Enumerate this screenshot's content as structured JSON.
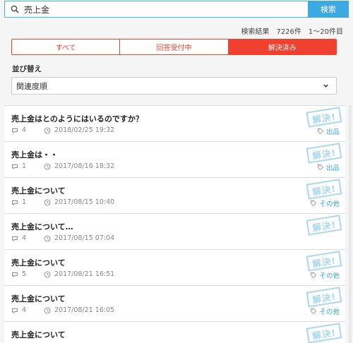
{
  "search": {
    "query": "売上金",
    "button_label": "検索"
  },
  "result_info": {
    "label": "検索結果",
    "count": "7226件",
    "range": "1〜20件目"
  },
  "tabs": [
    {
      "label": "すべて"
    },
    {
      "label": "回答受付中"
    },
    {
      "label": "解決済み"
    }
  ],
  "sort": {
    "label": "並び替え",
    "selected": "関連度順"
  },
  "stamp_text": "解決!",
  "questions": [
    {
      "title": "売上金はとのようにはいるのですか？",
      "answers": "4",
      "date": "2018/02/25 19:32",
      "category": "出品"
    },
    {
      "title": "売上金は・・",
      "answers": "1",
      "date": "2017/08/16 18:32",
      "category": "出品"
    },
    {
      "title": "売上金について",
      "answers": "1",
      "date": "2017/08/15 10:40",
      "category": "その他"
    },
    {
      "title": "売上金について…",
      "answers": "4",
      "date": "2017/08/15 07:04",
      "category": ""
    },
    {
      "title": "売上金について",
      "answers": "5",
      "date": "2017/08/21 16:51",
      "category": "その他"
    },
    {
      "title": "売上金について",
      "answers": "4",
      "date": "2017/08/21 16:05",
      "category": "その他"
    },
    {
      "title": "売上金について",
      "answers": "",
      "date": "",
      "category": ""
    }
  ],
  "colors": {
    "accent_red": "#ef4030",
    "accent_blue": "#3ca9e0",
    "stamp": "#9fd3ef"
  }
}
